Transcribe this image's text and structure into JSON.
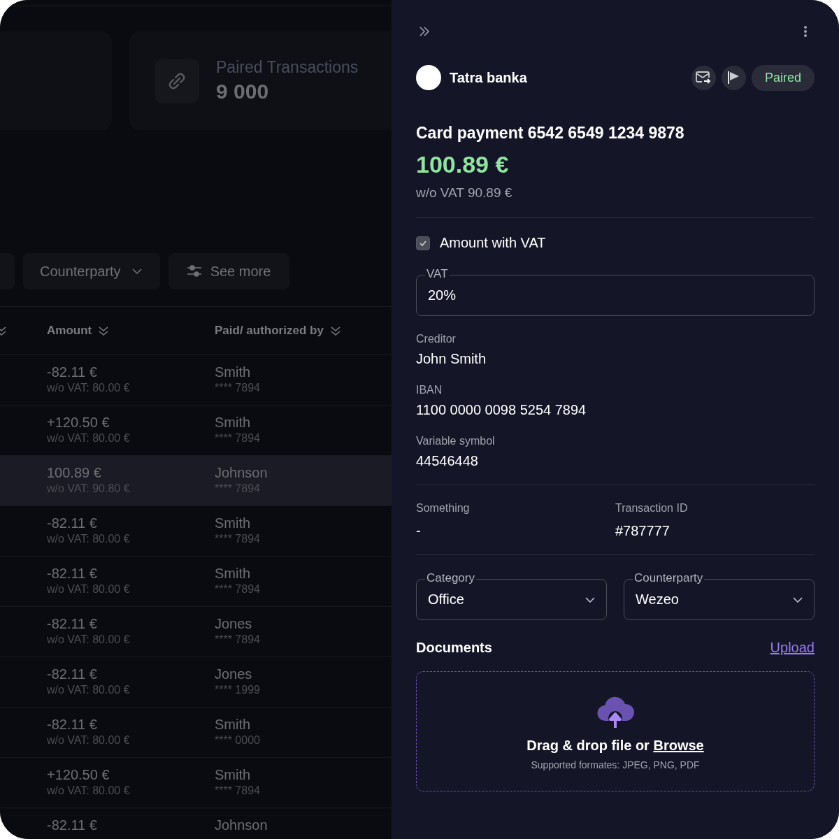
{
  "summary_cards": [
    {
      "kind": "blank"
    },
    {
      "kind": "stat",
      "label": "Paired Transactions",
      "value": "9 000"
    }
  ],
  "filters": [
    {
      "kind": "blank"
    },
    {
      "kind": "dropdown",
      "label": "Counterparty"
    },
    {
      "kind": "more",
      "label": "See more"
    }
  ],
  "table": {
    "columns": [
      {
        "label": "Amount"
      },
      {
        "label": "Paid/ authorized by"
      }
    ],
    "rows": [
      {
        "amount": "-82.11 €",
        "net": "w/o VAT: 80.00 €",
        "payer": "Smith",
        "card": "**** 7894",
        "selected": false
      },
      {
        "amount": "+120.50 €",
        "net": "w/o VAT: 80.00 €",
        "payer": "Smith",
        "card": "**** 7894",
        "selected": false
      },
      {
        "amount": "100.89 €",
        "net": "w/o VAT: 90.80 €",
        "payer": "Johnson",
        "card": "**** 7894",
        "selected": true
      },
      {
        "amount": "-82.11 €",
        "net": "w/o VAT: 80.00 €",
        "payer": "Smith",
        "card": "**** 7894",
        "selected": false
      },
      {
        "amount": "-82.11 €",
        "net": "w/o VAT: 80.00 €",
        "payer": "Smith",
        "card": "**** 7894",
        "selected": false
      },
      {
        "amount": "-82.11 €",
        "net": "w/o VAT: 80.00 €",
        "payer": "Jones",
        "card": "**** 7894",
        "selected": false
      },
      {
        "amount": "-82.11 €",
        "net": "w/o VAT: 80.00 €",
        "payer": "Jones",
        "card": "**** 1999",
        "selected": false
      },
      {
        "amount": "-82.11 €",
        "net": "w/o VAT: 80.00 €",
        "payer": "Smith",
        "card": "**** 0000",
        "selected": false
      },
      {
        "amount": "+120.50 €",
        "net": "w/o VAT: 80.00 €",
        "payer": "Smith",
        "card": "**** 7894",
        "selected": false
      },
      {
        "amount": "-82.11 €",
        "payer": "Johnson",
        "selected": false
      }
    ]
  },
  "detail": {
    "bank": "Tatra banka",
    "status": "Paired",
    "title": "Card payment 6542 6549 1234 9878",
    "amount": "100.89 €",
    "net": "w/o VAT 90.89 €",
    "vat_checkbox": {
      "label": "Amount with VAT",
      "checked": true
    },
    "vat_field": {
      "label": "VAT",
      "value": "20%"
    },
    "fields": [
      {
        "label": "Creditor",
        "value": "John Smith"
      },
      {
        "label": "IBAN",
        "value": "1100 0000 0098 5254 7894"
      },
      {
        "label": "Variable symbol",
        "value": "44546448"
      }
    ],
    "meta": [
      {
        "label": "Something",
        "value": "-"
      },
      {
        "label": "Transaction ID",
        "value": "#787777"
      }
    ],
    "selects": [
      {
        "label": "Category",
        "value": "Office"
      },
      {
        "label": "Counterparty",
        "value": "Wezeo"
      }
    ],
    "documents": {
      "title": "Documents",
      "upload": "Upload",
      "text": "Drag & drop file or",
      "link": "Browse",
      "hint": "Supported formates: JPEG, PNG, PDF"
    }
  }
}
